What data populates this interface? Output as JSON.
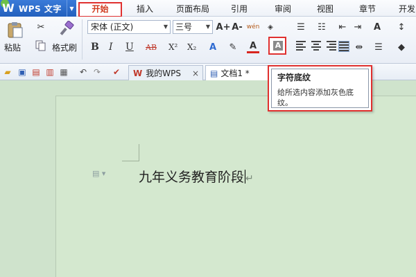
{
  "app": {
    "name": "WPS 文字",
    "logo_letter": "W"
  },
  "menu": {
    "tabs": [
      {
        "label": "开始",
        "active": true
      },
      {
        "label": "插入"
      },
      {
        "label": "页面布局"
      },
      {
        "label": "引用"
      },
      {
        "label": "审阅"
      },
      {
        "label": "视图"
      },
      {
        "label": "章节"
      },
      {
        "label": "开发"
      }
    ]
  },
  "ribbon": {
    "paste_label": "粘贴",
    "format_painter_label": "格式刷",
    "font_name": "宋体 (正文)",
    "font_size": "三号",
    "bold": "B",
    "italic": "I",
    "underline": "U",
    "strike": "AB",
    "superscript": "X²",
    "subscript": "X₂",
    "font_color_letter": "A",
    "pinyin": "wén",
    "shading_letter": "A",
    "grow_letter": "A+",
    "shrink_letter": "A-"
  },
  "tabs": [
    {
      "label": "我的WPS",
      "active": false
    },
    {
      "label": "文档1 *",
      "active": true
    }
  ],
  "document": {
    "text": "九年义务教育阶段"
  },
  "tooltip": {
    "title": "字符底纹",
    "body": "给所选内容添加灰色底纹。"
  },
  "colors": {
    "highlight_red": "#e0302f",
    "accent_blue": "#2360bd",
    "doc_bg": "#cfe3cc"
  }
}
